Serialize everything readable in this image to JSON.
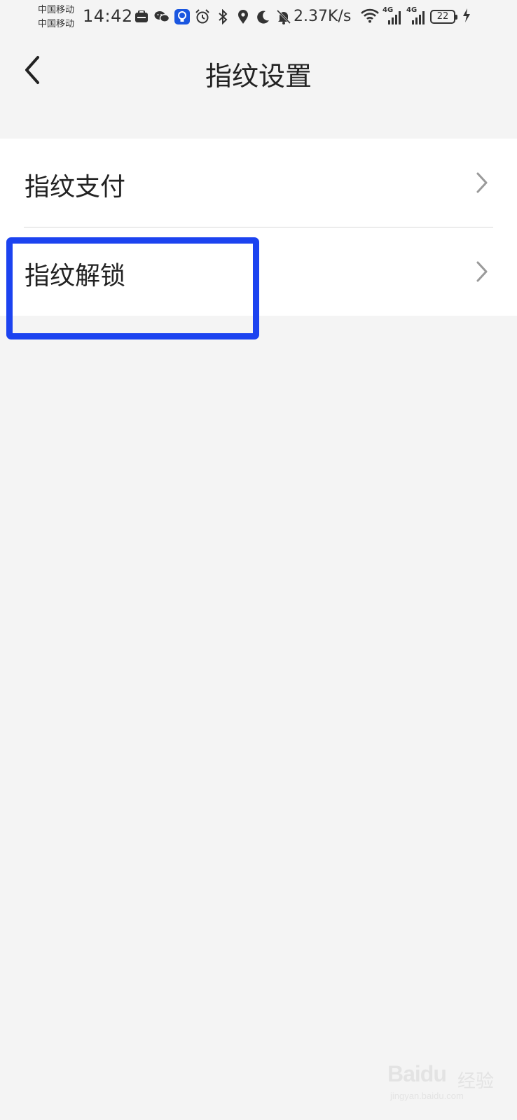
{
  "status_bar": {
    "carrier_1": "中国移动",
    "carrier_2": "中国移动",
    "time": "14:42",
    "net_speed": "2.37K/s",
    "signal_1_label": "4G",
    "signal_2_label": "4G",
    "battery_level": "22",
    "icons": [
      "huawei-app-icon",
      "wechat-icon",
      "bulb-app-icon",
      "alarm-icon",
      "bluetooth-icon",
      "location-icon",
      "moon-icon",
      "bell-off-icon",
      "wifi-icon",
      "signal-icon",
      "battery-icon",
      "charging-icon"
    ]
  },
  "header": {
    "title": "指纹设置",
    "back_icon": "chevron-left-icon"
  },
  "list": {
    "items": [
      {
        "label": "指纹支付"
      },
      {
        "label": "指纹解锁"
      }
    ]
  },
  "annotation": {
    "highlight_color": "#1c43f0"
  },
  "watermark": {
    "logo": "Baidu",
    "brand": "经验",
    "url": "jingyan.baidu.com"
  },
  "colors": {
    "background": "#f4f4f4",
    "card": "#ffffff",
    "text": "#222222",
    "chevron": "#9a9a9a"
  }
}
